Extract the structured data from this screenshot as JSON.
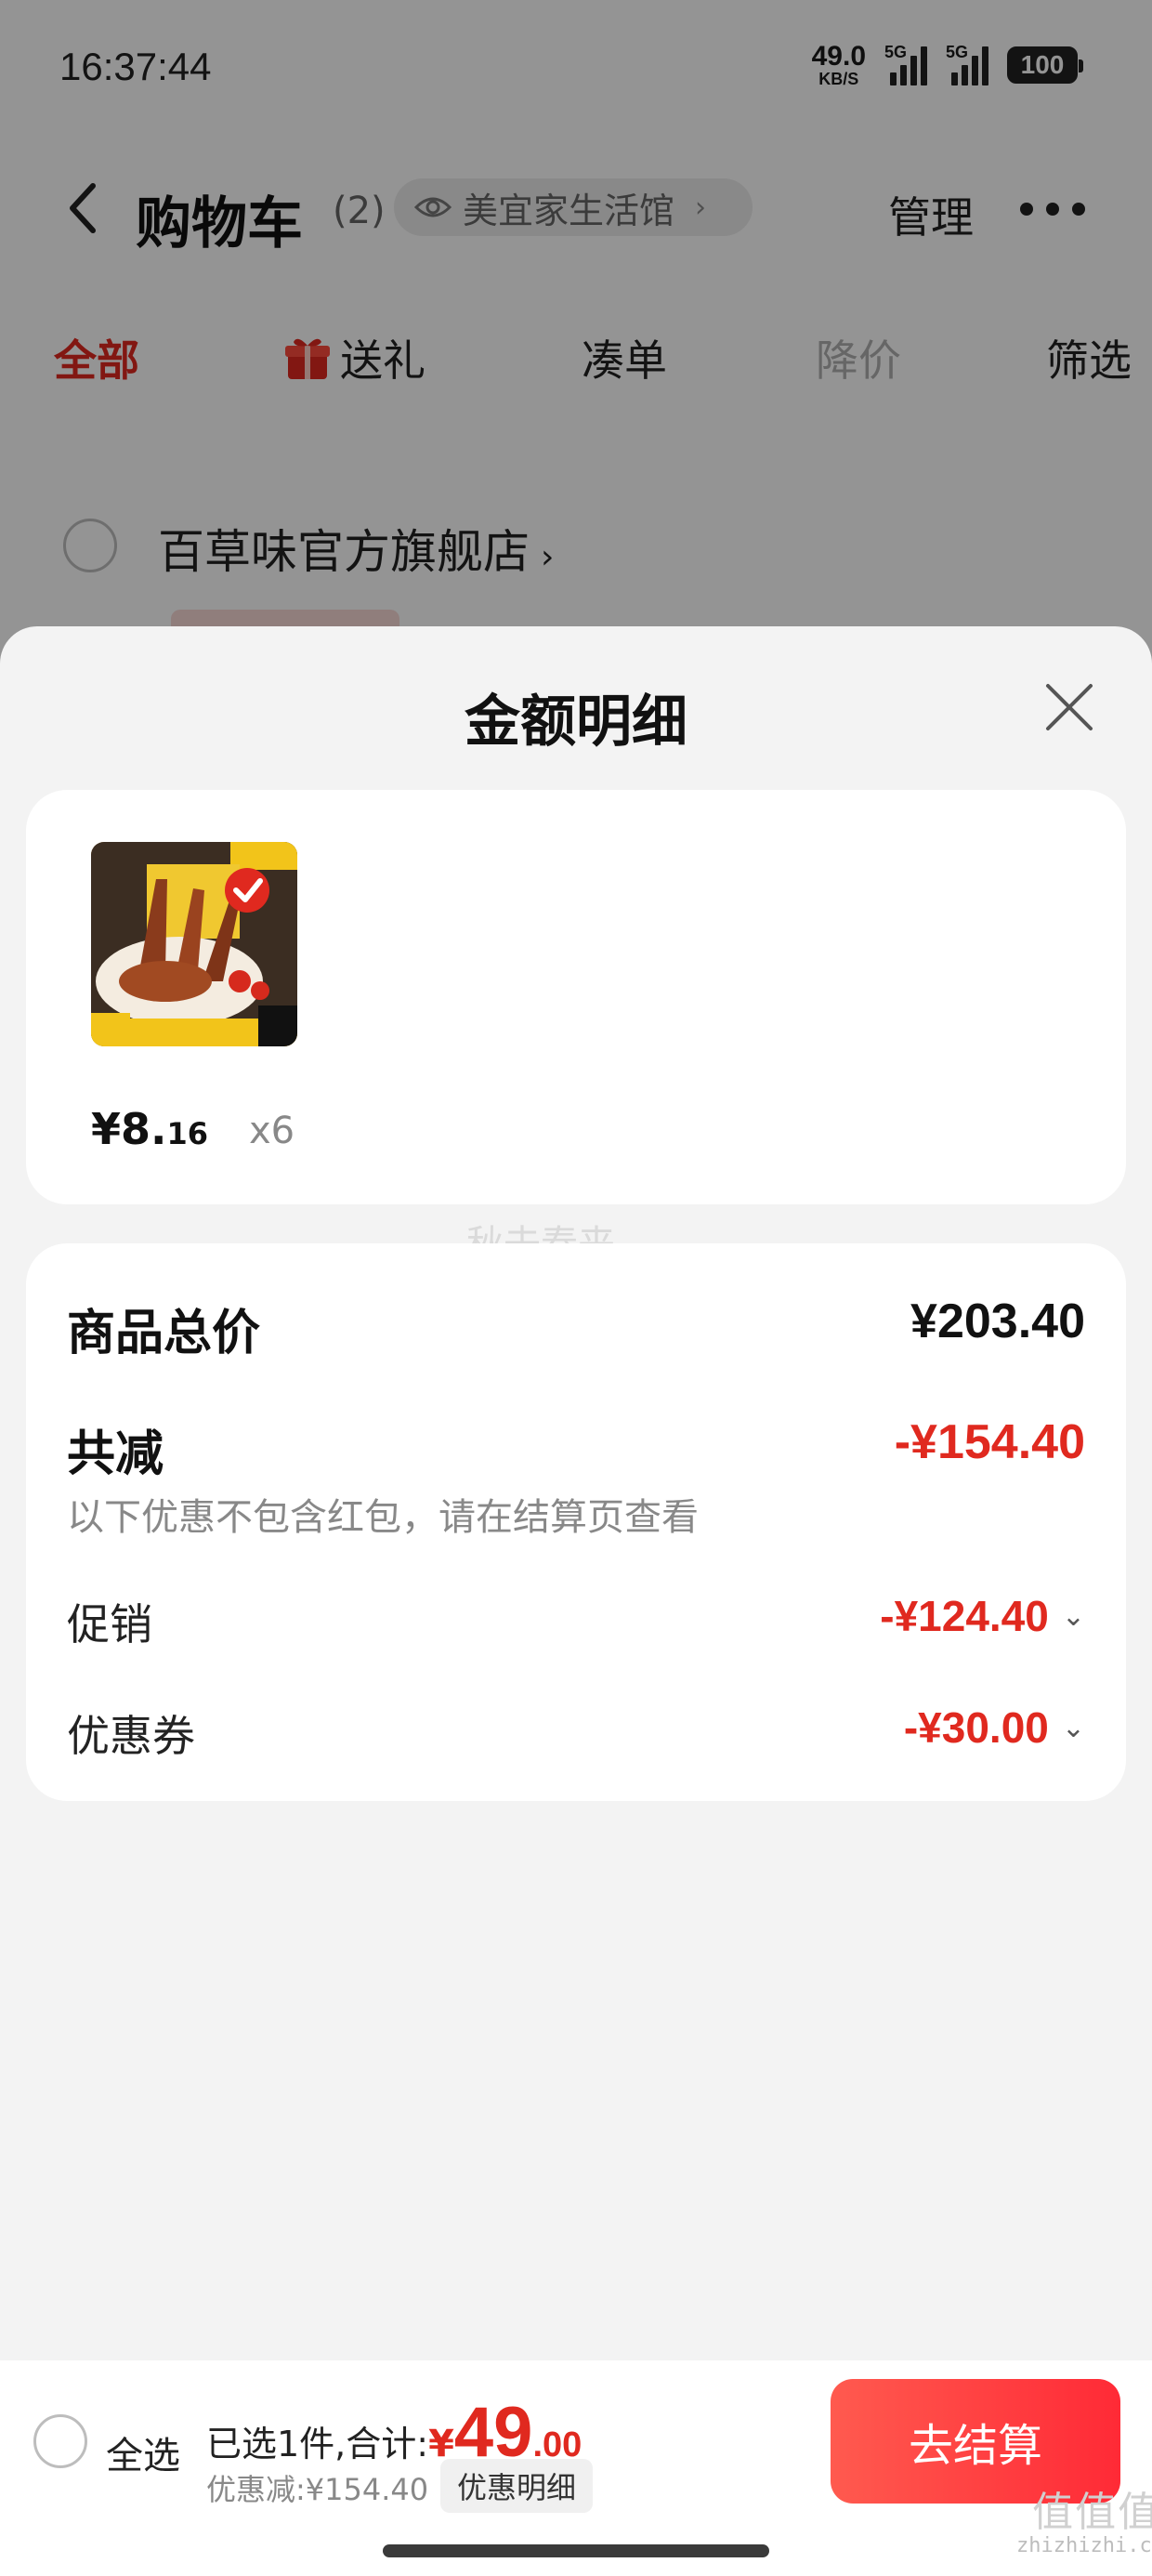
{
  "status": {
    "time": "16:37:44",
    "net_speed": "49.0",
    "net_unit": "KB/S",
    "sig1_label": "5G",
    "sig2_label": "5G",
    "battery": "100"
  },
  "header": {
    "title": "购物车",
    "count": "(2)",
    "store_link": "美宜家生活馆",
    "manage": "管理"
  },
  "filter_tabs": [
    "全部",
    "送礼",
    "凑单",
    "降价",
    "筛选"
  ],
  "store": {
    "name": "百草味官方旗舰店"
  },
  "sheet": {
    "title": "金额明细",
    "product": {
      "price_main": "¥8.",
      "price_cents": "16",
      "qty": "x6"
    },
    "watermark": "秋去春来",
    "rows": {
      "total_label": "商品总价",
      "total_value": "¥203.40",
      "reduce_label": "共减",
      "reduce_value": "-¥154.40",
      "note": "以下优惠不包含红包，请在结算页查看",
      "promo_label": "促销",
      "promo_value": "-¥124.40",
      "coupon_label": "优惠券",
      "coupon_value": "-¥30.00"
    }
  },
  "bottom": {
    "select_all": "全选",
    "selected_text": "已选1件,合计:",
    "currency": "¥",
    "total_int": "49",
    "total_dec": ".00",
    "discount": "优惠减:¥154.40",
    "discount_detail": "优惠明细",
    "checkout": "去结算"
  },
  "corner_watermark": {
    "big": "值值值",
    "small": "zhizhizhi.com"
  },
  "colors": {
    "accent": "#e0291f",
    "checkout_gradient": [
      "#ff5a4f",
      "#ff2a36"
    ]
  }
}
